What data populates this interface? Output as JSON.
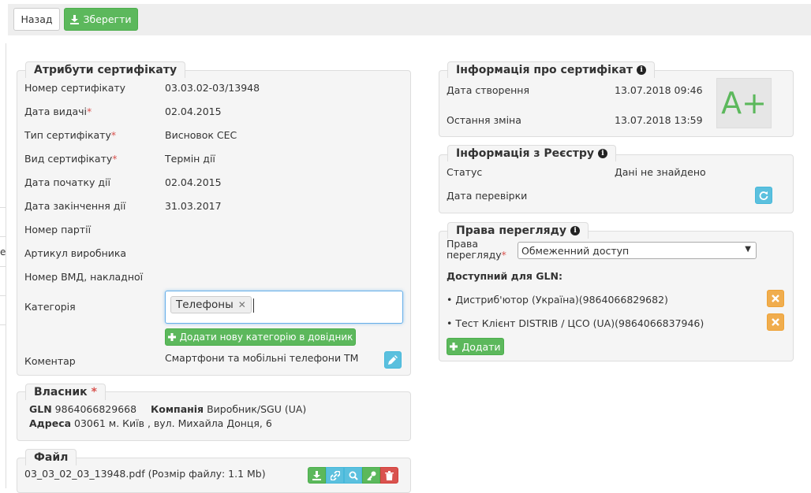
{
  "toolbar": {
    "back_label": "Назад",
    "save_label": "Зберегти"
  },
  "attributes": {
    "title": "Атрибути сертифікату",
    "cert_number_label": "Номер сертифікату",
    "cert_number": "03.03.02-03/13948",
    "issue_date_label": "Дата видачі",
    "issue_date": "02.04.2015",
    "cert_type_label": "Тип сертифікату",
    "cert_type": "Висновок СЕС",
    "cert_kind_label": "Вид сертифікату",
    "cert_kind": "Термін дії",
    "start_date_label": "Дата початку дії",
    "start_date": "02.04.2015",
    "end_date_label": "Дата закінчення дії",
    "end_date": "31.03.2017",
    "batch_label": "Номер партії",
    "article_label": "Артикул виробника",
    "vmd_label": "Номер ВМД, накладної",
    "category_label": "Категорія",
    "category_tag": "Телефоны",
    "add_category_label": "Додати нову категорію в довідник",
    "comment_label": "Коментар",
    "comment": "Смартфони та мобільні телефони ТМ"
  },
  "owner": {
    "title": "Власник",
    "gln_label": "GLN",
    "gln": "9864066829668",
    "company_label": "Компанія",
    "company": "Виробник/SGU (UA)",
    "address_label": "Адреса",
    "address": "03061 м. Київ , вул. Михайла Донця, 6"
  },
  "file": {
    "title": "Файл",
    "name_text": "03_03_02_03_13948.pdf (Розмір файлу: 1.1 Mb)"
  },
  "cert_info": {
    "title": "Інформація про сертифікат",
    "created_label": "Дата створення",
    "created": "13.07.2018 09:46",
    "modified_label": "Остання зміна",
    "modified": "13.07.2018 13:59",
    "grade": "A+"
  },
  "registry": {
    "title": "Інформація з Реєстру",
    "status_label": "Статус",
    "status": "Дані не знайдено",
    "check_date_label": "Дата перевірки"
  },
  "view_rights": {
    "title": "Права перегляду",
    "rights_label_line1": "Права",
    "rights_label_line2": "перегляду",
    "rights_value": "Обмеженний доступ",
    "available_label": "Доступний для GLN:",
    "gln_items": [
      {
        "text": "• Дистриб'ютор (Україна)(9864066829682)"
      },
      {
        "text": "• Тест Клієнт DISTRIB / ЦСО (UA)(9864066837946)"
      }
    ],
    "add_label": "Додати"
  },
  "colors": {
    "green": "#5cb85c",
    "blue": "#5bc0de",
    "orange": "#f0ad4e",
    "red": "#d9534f",
    "required": "#d9534f"
  },
  "icons": [
    "download-icon",
    "plus-icon",
    "pencil-icon",
    "refresh-icon",
    "info-icon",
    "times-icon",
    "link-icon",
    "zoom-icon",
    "key-icon",
    "trash-icon"
  ]
}
